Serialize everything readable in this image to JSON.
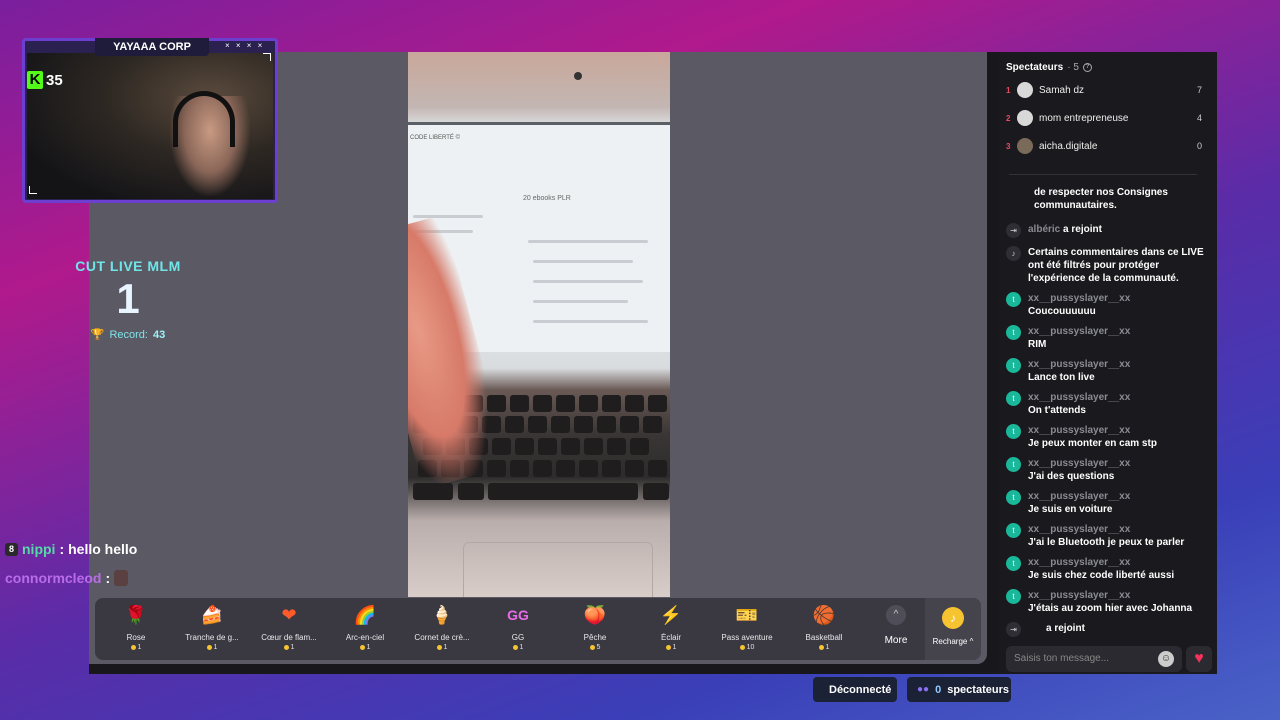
{
  "webcam": {
    "channel": "YAYAAA CORP",
    "deco": "× × × ×",
    "kick_badge": "K",
    "kick_count": "35"
  },
  "counter": {
    "label": "CUT LIVE MLM",
    "value": "1",
    "record_label": "Record:",
    "record_value": "43"
  },
  "video": {
    "screen_title": "CODE LIBERTÉ ©",
    "screen_heading": "20 ebooks PLR"
  },
  "overlay_chat": [
    {
      "user": "nippi",
      "sep": ":",
      "message": "hello hello"
    },
    {
      "user": "connormcleod",
      "sep": ":",
      "message": ""
    }
  ],
  "gifts": [
    {
      "name": "Rose",
      "price": "1",
      "icon": "🌹"
    },
    {
      "name": "Tranche de g...",
      "price": "1",
      "icon": "🍰"
    },
    {
      "name": "Cœur de flam...",
      "price": "1",
      "icon": "❤"
    },
    {
      "name": "Arc-en-ciel",
      "price": "1",
      "icon": "🌈"
    },
    {
      "name": "Cornet de crè...",
      "price": "1",
      "icon": "🍦"
    },
    {
      "name": "GG",
      "price": "1",
      "icon": "GG"
    },
    {
      "name": "Pêche",
      "price": "5",
      "icon": "🍑"
    },
    {
      "name": "Éclair",
      "price": "1",
      "icon": "⚡"
    },
    {
      "name": "Pass aventure",
      "price": "10",
      "icon": "🎫"
    },
    {
      "name": "Basketball",
      "price": "1",
      "icon": "🏀"
    }
  ],
  "more_label": "More",
  "more_icon": "^",
  "recharge_label": "Recharge ^",
  "viewers": {
    "title": "Spectateurs",
    "count": "· 5",
    "list": [
      {
        "rank": "1",
        "name": "Samah dz",
        "score": "7"
      },
      {
        "rank": "2",
        "name": "mom entrepreneuse",
        "score": "4"
      },
      {
        "rank": "3",
        "name": "aicha.digitale",
        "score": "0"
      }
    ]
  },
  "chat": {
    "system_partial": "de respecter nos Consignes communautaires.",
    "join1_user": "albéric",
    "join1_text": "a rejoint",
    "filter_notice": "Certains commentaires dans ce LIVE ont été filtrés pour protéger l'expérience de la communauté.",
    "messages": [
      {
        "user": "xx__pussyslayer__xx",
        "text": "Coucouuuuuu"
      },
      {
        "user": "xx__pussyslayer__xx",
        "text": "RIM"
      },
      {
        "user": "xx__pussyslayer__xx",
        "text": "Lance ton live"
      },
      {
        "user": "xx__pussyslayer__xx",
        "text": "On t'attends"
      },
      {
        "user": "xx__pussyslayer__xx",
        "text": "Je peux monter en cam stp"
      },
      {
        "user": "xx__pussyslayer__xx",
        "text": "J'ai des questions"
      },
      {
        "user": "xx__pussyslayer__xx",
        "text": "Je suis en voiture"
      },
      {
        "user": "xx__pussyslayer__xx",
        "text": "J'ai le Bluetooth je peux te parler"
      },
      {
        "user": "xx__pussyslayer__xx",
        "text": "Je suis chez code liberté aussi"
      },
      {
        "user": "xx__pussyslayer__xx",
        "text": "J'étais au zoom hier avec Johanna"
      }
    ],
    "join2_text": "a rejoint",
    "input_placeholder": "Saisis ton message..."
  },
  "status": {
    "connection": "Déconnecté",
    "viewers_count": "0",
    "viewers_label": "spectateurs"
  },
  "colors": {
    "accent_purple": "#6d3fd0",
    "kick_green": "#53fc18",
    "counter_cyan": "#6fe5e8",
    "heart_red": "#f2335a"
  }
}
